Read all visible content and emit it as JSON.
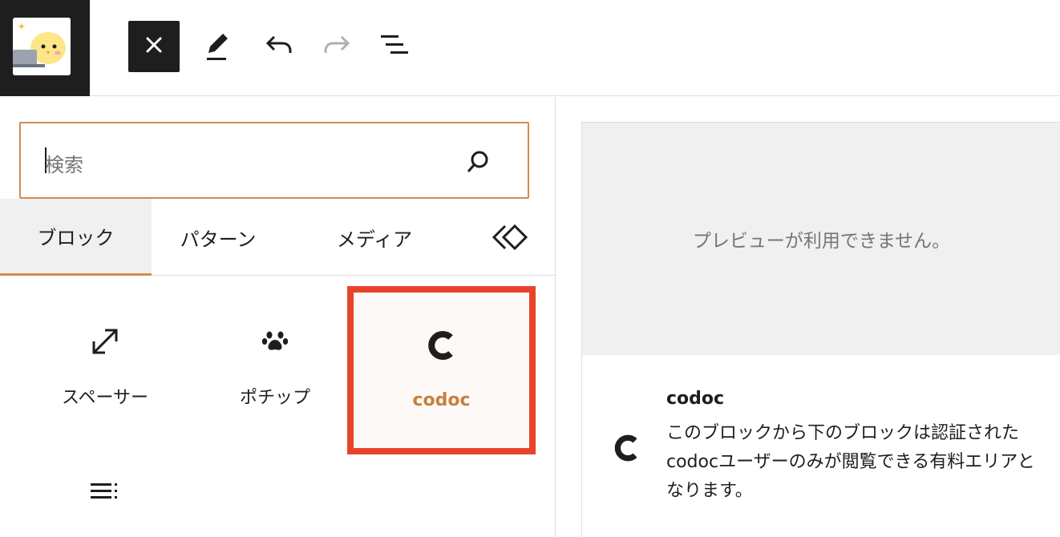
{
  "toolbar": {
    "close_icon": "close-icon",
    "tools": [
      "pencil-icon",
      "undo-icon",
      "redo-icon",
      "list-view-icon"
    ]
  },
  "inserter": {
    "search": {
      "placeholder": "検索",
      "value": ""
    },
    "tabs": [
      {
        "label": "ブロック",
        "active": true
      },
      {
        "label": "パターン",
        "active": false
      },
      {
        "label": "メディア",
        "active": false
      }
    ],
    "blocks": [
      {
        "label": "スペーサー",
        "icon": "resize-arrows-icon",
        "selected": false
      },
      {
        "label": "ポチップ",
        "icon": "paw-icon",
        "selected": false
      },
      {
        "label": "codoc",
        "icon": "codoc-icon",
        "selected": true
      },
      {
        "label": "",
        "icon": "list-icon",
        "selected": false
      }
    ]
  },
  "preview": {
    "unavailable_text": "プレビューが利用できません。",
    "block_title": "codoc",
    "block_description": "このブロックから下のブロックは認証されたcodocユーザーのみが閲覧できる有料エリアとなります。"
  },
  "colors": {
    "accent": "#d18c4e",
    "highlight": "#e8432a",
    "dark": "#1e1e1e"
  }
}
